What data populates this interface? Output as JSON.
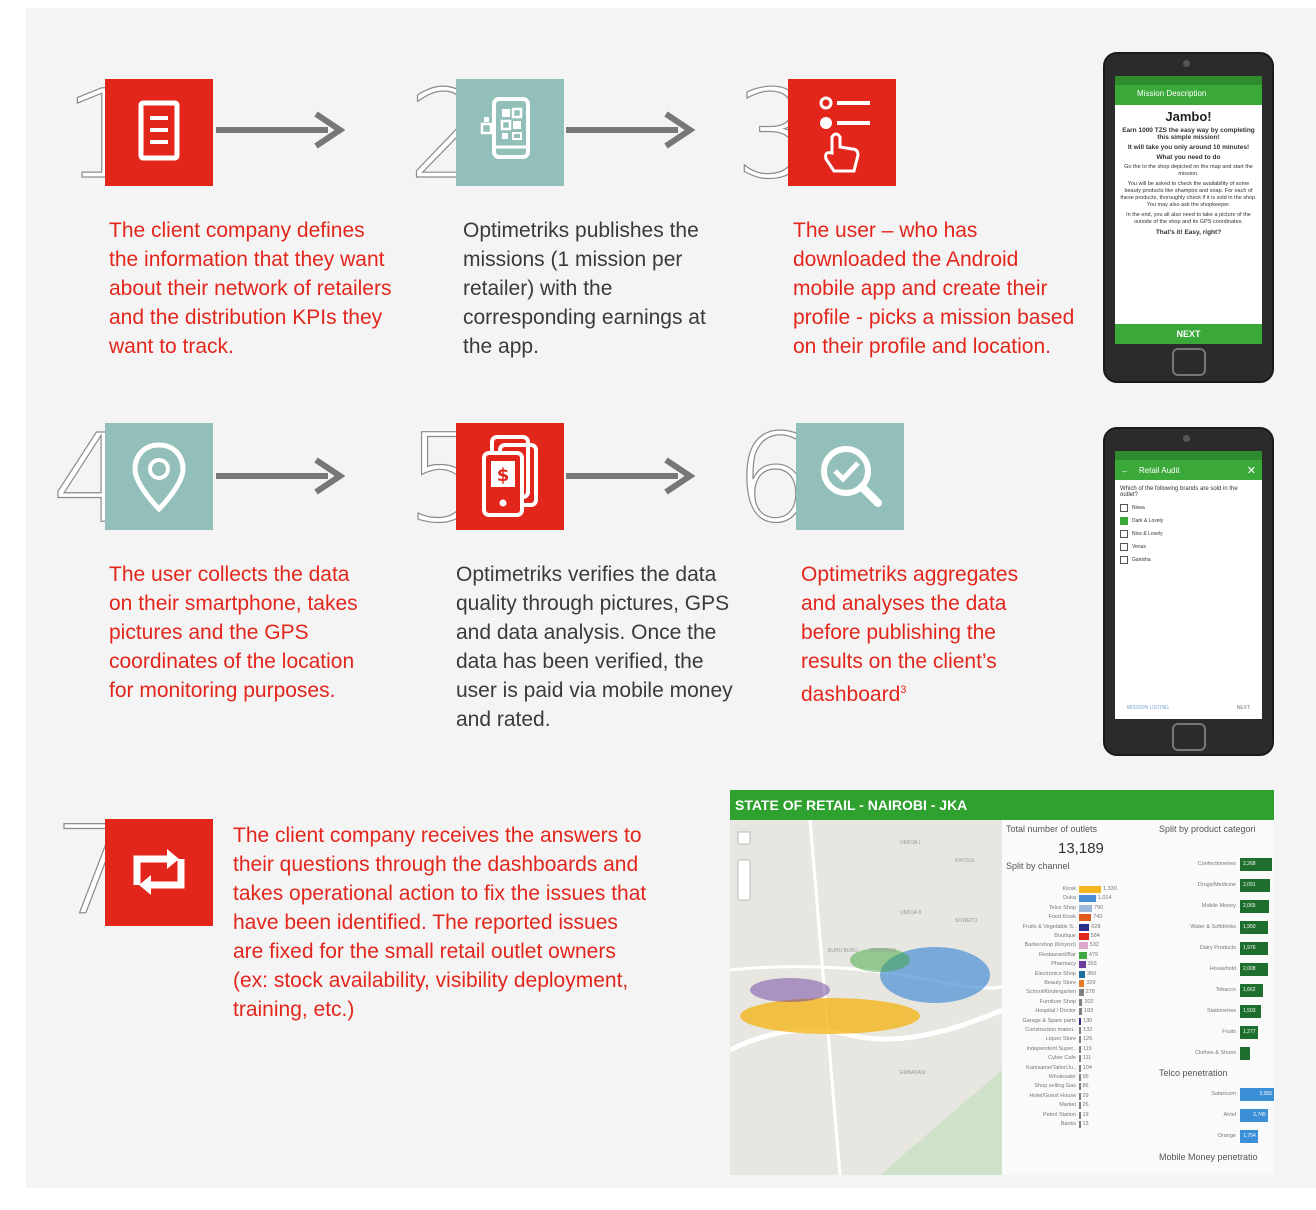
{
  "steps": [
    {
      "number": "1",
      "icon": "document-icon",
      "text": "The client company defines the information that they want about their network of retailers and the distribution KPIs they want to track."
    },
    {
      "number": "2",
      "icon": "mobile-qr-icon",
      "text": "Optimetriks publishes the missions (1 mission per retailer) with the corresponding earnings at the app."
    },
    {
      "number": "3",
      "icon": "checklist-tap-icon",
      "text": "The user – who has downloaded the Android mobile app and create their profile - picks a mission based on their profile and location."
    },
    {
      "number": "4",
      "icon": "location-pin-icon",
      "text": "The user collects the data on their smartphone, takes pictures and the GPS coordinates of the location for monitoring purposes."
    },
    {
      "number": "5",
      "icon": "mobile-money-icon",
      "text": "Optimetriks verifies the data quality through pictures, GPS and data analysis. Once the data has been verified, the user is paid via mobile money and rated."
    },
    {
      "number": "6",
      "icon": "magnifier-check-icon",
      "text": "Optimetriks aggregates and analyses the data before publishing the results on the client’s dashboard",
      "sup": "3"
    },
    {
      "number": "7",
      "icon": "repeat-icon",
      "text": "The client company receives the answers to their questions through the dashboards and takes operational action to fix the issues that have been identified. The reported issues are fixed for the small retail outlet owners (ex: stock availability, visibility deployment, training, etc.)"
    }
  ],
  "phone1": {
    "appbar": "Mission Description",
    "title": "Jambo!",
    "lines": [
      "Earn 1000 TZS the easy way by completing this simple mission!",
      "It will take you only around 10 minutes!",
      "What you need to do",
      "Go the to the shop depicted on the map and start the mission.",
      "You will be asked to check the availability of some beauty products like shampoo and soap. For each of these products, thoroughly check if it is sold in the shop. You may also ask the shopkeeper.",
      "In the end, you all also need to take a picture of the outside of the shop and its GPS coordinates.",
      "That's it! Easy, right?"
    ],
    "next": "NEXT"
  },
  "phone2": {
    "appbar": "Retail Audit",
    "question": "Which of the following brands are sold in the outlet?",
    "options": [
      {
        "label": "Nivea",
        "checked": false
      },
      {
        "label": "Dark & Lovely",
        "checked": true
      },
      {
        "label": "Nice & Lovely",
        "checked": false
      },
      {
        "label": "Venus",
        "checked": false
      },
      {
        "label": "Ganisha",
        "checked": false
      }
    ],
    "footer_left": "MISSION LISTING",
    "footer_right": "NEXT"
  },
  "dashboard": {
    "title": "STATE OF RETAIL - NAIROBI - JKA",
    "total_label": "Total number of outlets",
    "total_value": "13,189",
    "split_channel": "Split by channel",
    "split_product": "Split by product categori",
    "telco": "Telco penetration",
    "mobile_money": "Mobile Money penetratio",
    "map_labels": [
      "KAYOLE",
      "UMOJA II",
      "SOWETO",
      "BURU BURU",
      "DONHOLM",
      "EMBAKASI",
      "UMOJA I"
    ],
    "channels": [
      {
        "name": "Kiosk",
        "value": "1,330",
        "color": "#f2b51b"
      },
      {
        "name": "Duka",
        "value": "1,014",
        "color": "#4a8fd6"
      },
      {
        "name": "Telco Shop",
        "value": "790",
        "color": "#9bb8d9"
      },
      {
        "name": "Food Kiosk",
        "value": "740",
        "color": "#e05a1c"
      },
      {
        "name": "Fruits & Vegetable S..",
        "value": "628",
        "color": "#2a2e8a"
      },
      {
        "name": "Boutique",
        "value": "584",
        "color": "#e3261c"
      },
      {
        "name": "Barbershop (Kinyozi)",
        "value": "532",
        "color": "#d9a7c9"
      },
      {
        "name": "Restaurant/Bar",
        "value": "479",
        "color": "#3fa83f"
      },
      {
        "name": "Pharmacy",
        "value": "393",
        "color": "#6b3fa0"
      },
      {
        "name": "Electronics Shop",
        "value": "360",
        "color": "#1f6f9e"
      },
      {
        "name": "Beauty Store",
        "value": "329",
        "color": "#e87b2a"
      },
      {
        "name": "School/Kindergarten",
        "value": "278",
        "color": "#7f7f7f"
      },
      {
        "name": "Furniture Shop",
        "value": "202",
        "color": "#7f7f7f"
      },
      {
        "name": "Hospital / Doctor",
        "value": "183",
        "color": "#7f7f7f"
      },
      {
        "name": "Garage & Spare parts",
        "value": "130",
        "color": "#2a2e8a"
      },
      {
        "name": "Construction materi..",
        "value": "132",
        "color": "#7f7f7f"
      },
      {
        "name": "Liquor Store",
        "value": "126",
        "color": "#7f7f7f"
      },
      {
        "name": "Independent Super..",
        "value": "119",
        "color": "#7f7f7f"
      },
      {
        "name": "Cyber Cafe",
        "value": "111",
        "color": "#7f7f7f"
      },
      {
        "name": "Kamsame/Tailor/Ju..",
        "value": "104",
        "color": "#7f7f7f"
      },
      {
        "name": "Wholesaler",
        "value": "95",
        "color": "#7f7f7f"
      },
      {
        "name": "Shop selling Gas",
        "value": "86",
        "color": "#7f7f7f"
      },
      {
        "name": "Hotel/Guest House",
        "value": "29",
        "color": "#7f7f7f"
      },
      {
        "name": "Market",
        "value": "26",
        "color": "#7f7f7f"
      },
      {
        "name": "Petrol Station",
        "value": "19",
        "color": "#7f7f7f"
      },
      {
        "name": "Banks",
        "value": "13",
        "color": "#7f7f7f"
      }
    ],
    "products": [
      {
        "name": "Confectioneries",
        "value": "2,268"
      },
      {
        "name": "Drugs/Medicine",
        "value": "2,091"
      },
      {
        "name": "Mobile Money",
        "value": "2,065"
      },
      {
        "name": "Water & Softdrinks",
        "value": "1,950"
      },
      {
        "name": "Dairy Products",
        "value": "1,976"
      },
      {
        "name": "Household",
        "value": "2,008"
      },
      {
        "name": "Tobacco",
        "value": "1,662"
      },
      {
        "name": "Stationeries",
        "value": "1,503"
      },
      {
        "name": "Fruits",
        "value": "1,277"
      },
      {
        "name": "Clothes & Shoes",
        "value": ""
      }
    ],
    "telcos": [
      {
        "name": "Safaricom",
        "value": "3,355"
      },
      {
        "name": "Airtel",
        "value": "2,745"
      },
      {
        "name": "Orange",
        "value": "1,754"
      }
    ],
    "colors": {
      "header": "#2ea12e",
      "product_bar": "#1e6e2e",
      "telco_bar": "#3b8fd6"
    }
  }
}
